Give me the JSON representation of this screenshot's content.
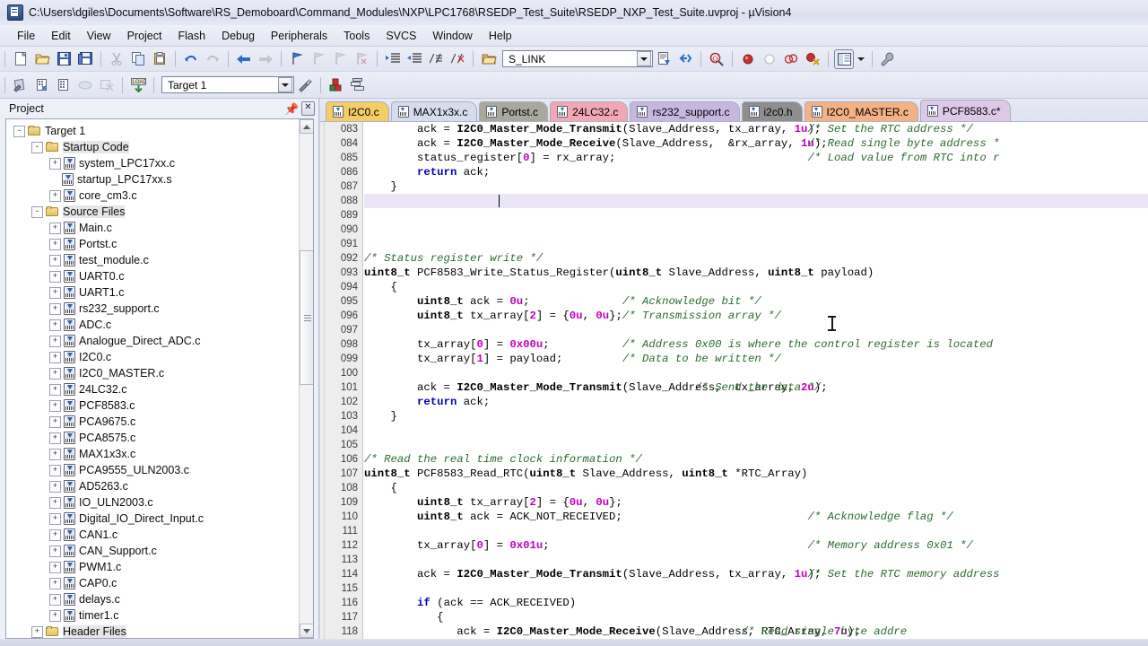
{
  "window": {
    "title": "C:\\Users\\dgiles\\Documents\\Software\\RS_Demoboard\\Command_Modules\\NXP\\LPC1768\\RSEDP_Test_Suite\\RSEDP_NXP_Test_Suite.uvproj - µVision4",
    "app_icon": "uvision-icon"
  },
  "menu": {
    "items": [
      "File",
      "Edit",
      "View",
      "Project",
      "Flash",
      "Debug",
      "Peripherals",
      "Tools",
      "SVCS",
      "Window",
      "Help"
    ]
  },
  "toolbar_main": {
    "link_combo_value": "S_LINK",
    "buttons": [
      "new-file-icon",
      "open-file-icon",
      "save-icon",
      "save-all-icon",
      "cut-icon",
      "copy-icon",
      "paste-icon",
      "undo-icon",
      "redo-icon",
      "navigate-back-icon",
      "navigate-forward-icon",
      "bookmark-toggle-icon",
      "bookmark-prev-icon",
      "bookmark-next-icon",
      "bookmark-clear-icon",
      "indent-icon",
      "outdent-icon",
      "comment-icon",
      "uncomment-icon",
      "open-folder-icon",
      "configure-target-icon",
      "find-in-files-icon",
      "breakpoint-insert-icon",
      "breakpoint-disable-icon",
      "breakpoint-kill-all-icon",
      "breakpoint-disable-all-icon",
      "window-layout-icon",
      "layout-dropdown-icon",
      "configure-wrench-icon"
    ]
  },
  "toolbar_build": {
    "target_combo_value": "Target 1",
    "buttons": [
      "translate-icon",
      "build-target-icon",
      "rebuild-all-icon",
      "batch-build-icon",
      "stop-build-icon",
      "download-icon",
      "target-options-icon",
      "manage-components-icon",
      "manage-multiproject-icon"
    ]
  },
  "project_panel": {
    "title": "Project",
    "pin_icon": "pin-icon",
    "close_icon": "close-icon",
    "tree": [
      {
        "label": "Target 1",
        "indent": 0,
        "type": "target",
        "expander": "-"
      },
      {
        "label": "Startup Code",
        "indent": 1,
        "type": "folder",
        "expander": "-"
      },
      {
        "label": "system_LPC17xx.c",
        "indent": 2,
        "type": "file",
        "expander": "+"
      },
      {
        "label": "startup_LPC17xx.s",
        "indent": 2,
        "type": "file",
        "expander": ""
      },
      {
        "label": "core_cm3.c",
        "indent": 2,
        "type": "file",
        "expander": "+"
      },
      {
        "label": "Source Files",
        "indent": 1,
        "type": "folder",
        "expander": "-"
      },
      {
        "label": "Main.c",
        "indent": 2,
        "type": "file",
        "expander": "+"
      },
      {
        "label": "Portst.c",
        "indent": 2,
        "type": "file",
        "expander": "+"
      },
      {
        "label": "test_module.c",
        "indent": 2,
        "type": "file",
        "expander": "+"
      },
      {
        "label": "UART0.c",
        "indent": 2,
        "type": "file",
        "expander": "+"
      },
      {
        "label": "UART1.c",
        "indent": 2,
        "type": "file",
        "expander": "+"
      },
      {
        "label": "rs232_support.c",
        "indent": 2,
        "type": "file",
        "expander": "+"
      },
      {
        "label": "ADC.c",
        "indent": 2,
        "type": "file",
        "expander": "+"
      },
      {
        "label": "Analogue_Direct_ADC.c",
        "indent": 2,
        "type": "file",
        "expander": "+"
      },
      {
        "label": "I2C0.c",
        "indent": 2,
        "type": "file",
        "expander": "+"
      },
      {
        "label": "I2C0_MASTER.c",
        "indent": 2,
        "type": "file",
        "expander": "+"
      },
      {
        "label": "24LC32.c",
        "indent": 2,
        "type": "file",
        "expander": "+"
      },
      {
        "label": "PCF8583.c",
        "indent": 2,
        "type": "file",
        "expander": "+"
      },
      {
        "label": "PCA9675.c",
        "indent": 2,
        "type": "file",
        "expander": "+"
      },
      {
        "label": "PCA8575.c",
        "indent": 2,
        "type": "file",
        "expander": "+"
      },
      {
        "label": "MAX1x3x.c",
        "indent": 2,
        "type": "file",
        "expander": "+"
      },
      {
        "label": "PCA9555_ULN2003.c",
        "indent": 2,
        "type": "file",
        "expander": "+"
      },
      {
        "label": "AD5263.c",
        "indent": 2,
        "type": "file",
        "expander": "+"
      },
      {
        "label": "IO_ULN2003.c",
        "indent": 2,
        "type": "file",
        "expander": "+"
      },
      {
        "label": "Digital_IO_Direct_Input.c",
        "indent": 2,
        "type": "file",
        "expander": "+"
      },
      {
        "label": "CAN1.c",
        "indent": 2,
        "type": "file",
        "expander": "+"
      },
      {
        "label": "CAN_Support.c",
        "indent": 2,
        "type": "file",
        "expander": "+"
      },
      {
        "label": "PWM1.c",
        "indent": 2,
        "type": "file",
        "expander": "+"
      },
      {
        "label": "CAP0.c",
        "indent": 2,
        "type": "file",
        "expander": "+"
      },
      {
        "label": "delays.c",
        "indent": 2,
        "type": "file",
        "expander": "+"
      },
      {
        "label": "timer1.c",
        "indent": 2,
        "type": "file",
        "expander": "+"
      },
      {
        "label": "Header Files",
        "indent": 1,
        "type": "folder",
        "expander": "+"
      }
    ]
  },
  "editor": {
    "tabs": [
      {
        "label": "I2C0.c",
        "color": "#f5cd66",
        "active": false
      },
      {
        "label": "MAX1x3x.c",
        "color": "#d4dcee",
        "active": false
      },
      {
        "label": "Portst.c",
        "color": "#a8a89c",
        "active": false
      },
      {
        "label": "24LC32.c",
        "color": "#f2a8b4",
        "active": false
      },
      {
        "label": "rs232_support.c",
        "color": "#c7b6e0",
        "active": false
      },
      {
        "label": "i2c0.h",
        "color": "#8e8e8e",
        "active": false
      },
      {
        "label": "I2C0_MASTER.c",
        "color": "#f4b183",
        "active": false
      },
      {
        "label": "PCF8583.c*",
        "color": "#ddc8e8",
        "active": true
      }
    ],
    "first_line_number": 83,
    "highlight_line": 88,
    "lines": [
      {
        "n": "083",
        "tokens": [
          {
            "t": "        ack = ",
            "c": "plain"
          },
          {
            "t": "I2C0_Master_Mode_Transmit",
            "c": "id"
          },
          {
            "t": "(Slave_Address, tx_array, ",
            "c": "plain"
          },
          {
            "t": "1u",
            "c": "num"
          },
          {
            "t": ");",
            "c": "plain"
          }
        ],
        "comment": "/* Set the RTC address */",
        "comment_col": 67
      },
      {
        "n": "084",
        "tokens": [
          {
            "t": "        ack = ",
            "c": "plain"
          },
          {
            "t": "I2C0_Master_Mode_Receive",
            "c": "id"
          },
          {
            "t": "(Slave_Address,  &rx_array, ",
            "c": "plain"
          },
          {
            "t": "1u",
            "c": "num"
          },
          {
            "t": ");",
            "c": "plain"
          }
        ],
        "comment": "/* Read single byte address *",
        "comment_col": 67
      },
      {
        "n": "085",
        "tokens": [
          {
            "t": "        status_register[",
            "c": "plain"
          },
          {
            "t": "0",
            "c": "num"
          },
          {
            "t": "] = rx_array;",
            "c": "plain"
          }
        ],
        "comment": "/* Load value from RTC into r",
        "comment_col": 67
      },
      {
        "n": "086",
        "tokens": [
          {
            "t": "        ",
            "c": "plain"
          },
          {
            "t": "return",
            "c": "kw"
          },
          {
            "t": " ack;",
            "c": "plain"
          }
        ],
        "comment": "",
        "comment_col": 0
      },
      {
        "n": "087",
        "tokens": [
          {
            "t": "    }",
            "c": "plain"
          }
        ],
        "comment": "",
        "comment_col": 0
      },
      {
        "n": "088",
        "tokens": [],
        "comment": "",
        "comment_col": 0
      },
      {
        "n": "089",
        "tokens": [],
        "comment": "",
        "comment_col": 0
      },
      {
        "n": "090",
        "tokens": [],
        "comment": "",
        "comment_col": 0
      },
      {
        "n": "091",
        "tokens": [],
        "comment": "",
        "comment_col": 0
      },
      {
        "n": "092",
        "tokens": [
          {
            "t": "/* Status register write */",
            "c": "cmt"
          }
        ],
        "comment": "",
        "comment_col": 0
      },
      {
        "n": "093",
        "tokens": [
          {
            "t": "uint8_t",
            "c": "id"
          },
          {
            "t": " PCF8583_Write_Status_Register(",
            "c": "plain"
          },
          {
            "t": "uint8_t",
            "c": "id"
          },
          {
            "t": " Slave_Address, ",
            "c": "plain"
          },
          {
            "t": "uint8_t",
            "c": "id"
          },
          {
            "t": " payload)",
            "c": "plain"
          }
        ],
        "comment": "",
        "comment_col": 0
      },
      {
        "n": "094",
        "tokens": [
          {
            "t": "    {",
            "c": "plain"
          }
        ],
        "comment": "",
        "comment_col": 0
      },
      {
        "n": "095",
        "tokens": [
          {
            "t": "        ",
            "c": "plain"
          },
          {
            "t": "uint8_t",
            "c": "id"
          },
          {
            "t": " ack = ",
            "c": "plain"
          },
          {
            "t": "0u",
            "c": "num"
          },
          {
            "t": ";",
            "c": "plain"
          }
        ],
        "comment": "/* Acknowledge bit */",
        "comment_col": 39
      },
      {
        "n": "096",
        "tokens": [
          {
            "t": "        ",
            "c": "plain"
          },
          {
            "t": "uint8_t",
            "c": "id"
          },
          {
            "t": " tx_array[",
            "c": "plain"
          },
          {
            "t": "2",
            "c": "num"
          },
          {
            "t": "] = {",
            "c": "plain"
          },
          {
            "t": "0u",
            "c": "num"
          },
          {
            "t": ", ",
            "c": "plain"
          },
          {
            "t": "0u",
            "c": "num"
          },
          {
            "t": "};",
            "c": "plain"
          }
        ],
        "comment": "/* Transmission array */",
        "comment_col": 39
      },
      {
        "n": "097",
        "tokens": [],
        "comment": "",
        "comment_col": 0
      },
      {
        "n": "098",
        "tokens": [
          {
            "t": "        tx_array[",
            "c": "plain"
          },
          {
            "t": "0",
            "c": "num"
          },
          {
            "t": "] = ",
            "c": "plain"
          },
          {
            "t": "0x00u",
            "c": "num"
          },
          {
            "t": ";",
            "c": "plain"
          }
        ],
        "comment": "/* Address 0x00 is where the control register is located",
        "comment_col": 39
      },
      {
        "n": "099",
        "tokens": [
          {
            "t": "        tx_array[",
            "c": "plain"
          },
          {
            "t": "1",
            "c": "num"
          },
          {
            "t": "] = payload;",
            "c": "plain"
          }
        ],
        "comment": "/* Data to be written */",
        "comment_col": 39
      },
      {
        "n": "100",
        "tokens": [],
        "comment": "",
        "comment_col": 0
      },
      {
        "n": "101",
        "tokens": [
          {
            "t": "        ack = ",
            "c": "plain"
          },
          {
            "t": "I2C0_Master_Mode_Transmit",
            "c": "id"
          },
          {
            "t": "(Slave_Address,  tx_array, ",
            "c": "plain"
          },
          {
            "t": "2u",
            "c": "num"
          },
          {
            "t": ");",
            "c": "plain"
          }
        ],
        "comment": "/* Send the data */",
        "comment_col": 50
      },
      {
        "n": "102",
        "tokens": [
          {
            "t": "        ",
            "c": "plain"
          },
          {
            "t": "return",
            "c": "kw"
          },
          {
            "t": " ack;",
            "c": "plain"
          }
        ],
        "comment": "",
        "comment_col": 0
      },
      {
        "n": "103",
        "tokens": [
          {
            "t": "    }",
            "c": "plain"
          }
        ],
        "comment": "",
        "comment_col": 0
      },
      {
        "n": "104",
        "tokens": [],
        "comment": "",
        "comment_col": 0
      },
      {
        "n": "105",
        "tokens": [],
        "comment": "",
        "comment_col": 0
      },
      {
        "n": "106",
        "tokens": [
          {
            "t": "/* Read the real time clock information */",
            "c": "cmt"
          }
        ],
        "comment": "",
        "comment_col": 0
      },
      {
        "n": "107",
        "tokens": [
          {
            "t": "uint8_t",
            "c": "id"
          },
          {
            "t": " PCF8583_Read_RTC(",
            "c": "plain"
          },
          {
            "t": "uint8_t",
            "c": "id"
          },
          {
            "t": " Slave_Address, ",
            "c": "plain"
          },
          {
            "t": "uint8_t",
            "c": "id"
          },
          {
            "t": " *RTC_Array)",
            "c": "plain"
          }
        ],
        "comment": "",
        "comment_col": 0
      },
      {
        "n": "108",
        "tokens": [
          {
            "t": "    {",
            "c": "plain"
          }
        ],
        "comment": "",
        "comment_col": 0
      },
      {
        "n": "109",
        "tokens": [
          {
            "t": "        ",
            "c": "plain"
          },
          {
            "t": "uint8_t",
            "c": "id"
          },
          {
            "t": " tx_array[",
            "c": "plain"
          },
          {
            "t": "2",
            "c": "num"
          },
          {
            "t": "] = {",
            "c": "plain"
          },
          {
            "t": "0u",
            "c": "num"
          },
          {
            "t": ", ",
            "c": "plain"
          },
          {
            "t": "0u",
            "c": "num"
          },
          {
            "t": "};",
            "c": "plain"
          }
        ],
        "comment": "",
        "comment_col": 0
      },
      {
        "n": "110",
        "tokens": [
          {
            "t": "        ",
            "c": "plain"
          },
          {
            "t": "uint8_t",
            "c": "id"
          },
          {
            "t": " ack = ACK_NOT_RECEIVED;",
            "c": "plain"
          }
        ],
        "comment": "/* Acknowledge flag */",
        "comment_col": 67
      },
      {
        "n": "111",
        "tokens": [],
        "comment": "",
        "comment_col": 0
      },
      {
        "n": "112",
        "tokens": [
          {
            "t": "        tx_array[",
            "c": "plain"
          },
          {
            "t": "0",
            "c": "num"
          },
          {
            "t": "] = ",
            "c": "plain"
          },
          {
            "t": "0x01u",
            "c": "num"
          },
          {
            "t": ";",
            "c": "plain"
          }
        ],
        "comment": "/* Memory address 0x01 */",
        "comment_col": 67
      },
      {
        "n": "113",
        "tokens": [],
        "comment": "",
        "comment_col": 0
      },
      {
        "n": "114",
        "tokens": [
          {
            "t": "        ack = ",
            "c": "plain"
          },
          {
            "t": "I2C0_Master_Mode_Transmit",
            "c": "id"
          },
          {
            "t": "(Slave_Address, tx_array, ",
            "c": "plain"
          },
          {
            "t": "1u",
            "c": "num"
          },
          {
            "t": ");",
            "c": "plain"
          }
        ],
        "comment": "/* Set the RTC memory address",
        "comment_col": 67
      },
      {
        "n": "115",
        "tokens": [],
        "comment": "",
        "comment_col": 0
      },
      {
        "n": "116",
        "tokens": [
          {
            "t": "        ",
            "c": "plain"
          },
          {
            "t": "if",
            "c": "kw"
          },
          {
            "t": " (ack == ACK_RECEIVED)",
            "c": "plain"
          }
        ],
        "comment": "",
        "comment_col": 0
      },
      {
        "n": "117",
        "tokens": [
          {
            "t": "           {",
            "c": "plain"
          }
        ],
        "comment": "",
        "comment_col": 0
      },
      {
        "n": "118",
        "tokens": [
          {
            "t": "              ack = ",
            "c": "plain"
          },
          {
            "t": "I2C0_Master_Mode_Receive",
            "c": "id"
          },
          {
            "t": "(Slave_Address, RTC_Array, ",
            "c": "plain"
          },
          {
            "t": "7u",
            "c": "num"
          },
          {
            "t": ");",
            "c": "plain"
          }
        ],
        "comment": "/* Read single byte addre",
        "comment_col": 57
      }
    ]
  },
  "colors": {
    "keyword": "#0000c0",
    "comment": "#2c6b2f",
    "number": "#c000c0",
    "highlight_row": "#eae6f7",
    "gutter_bg": "#ededed"
  }
}
